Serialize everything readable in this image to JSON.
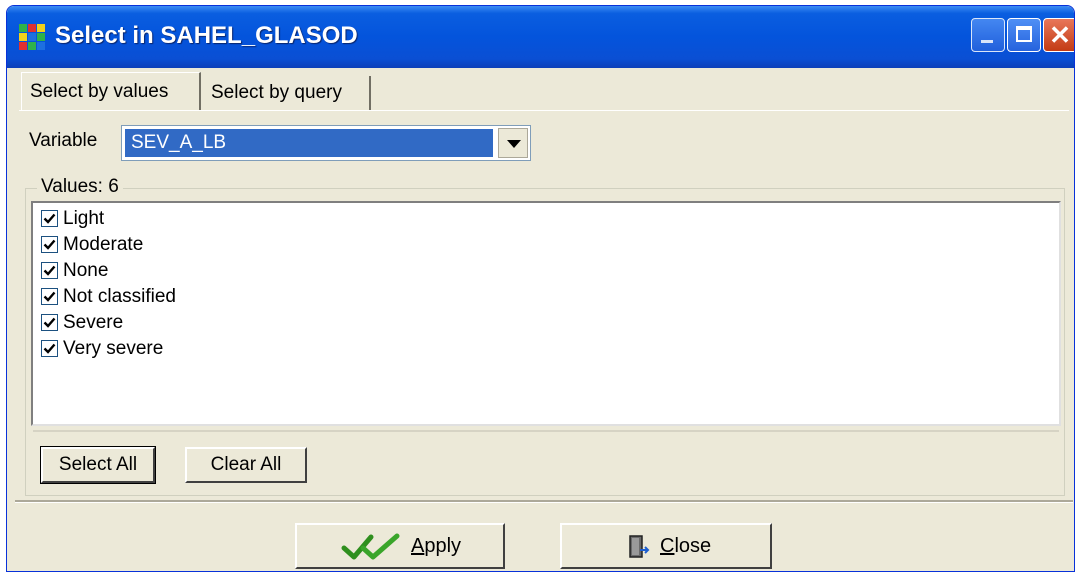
{
  "window": {
    "title": "Select in SAHEL_GLASOD",
    "controls": [
      "minimize",
      "maximize",
      "close"
    ]
  },
  "tabs": [
    {
      "label": "Select by values",
      "active": true
    },
    {
      "label": "Select by query",
      "active": false
    }
  ],
  "variable": {
    "label": "Variable",
    "selected": "SEV_A_LB"
  },
  "values_group": {
    "label": "Values: 6",
    "items": [
      {
        "label": "Light",
        "checked": true
      },
      {
        "label": "Moderate",
        "checked": true
      },
      {
        "label": "None",
        "checked": true
      },
      {
        "label": "Not classified",
        "checked": true
      },
      {
        "label": "Severe",
        "checked": true
      },
      {
        "label": "Very severe",
        "checked": true
      }
    ]
  },
  "buttons": {
    "select_all": "Select All",
    "clear_all": "Clear All",
    "apply": "Apply",
    "close": "Close"
  },
  "icons": {
    "app": "app-grid-icon",
    "apply": "double-check-icon",
    "close": "door-exit-icon"
  },
  "colors": {
    "titlebar": "#0454dc",
    "selection": "#316ac5",
    "dialog_bg": "#ece9d8",
    "close_button": "#c33b14"
  }
}
